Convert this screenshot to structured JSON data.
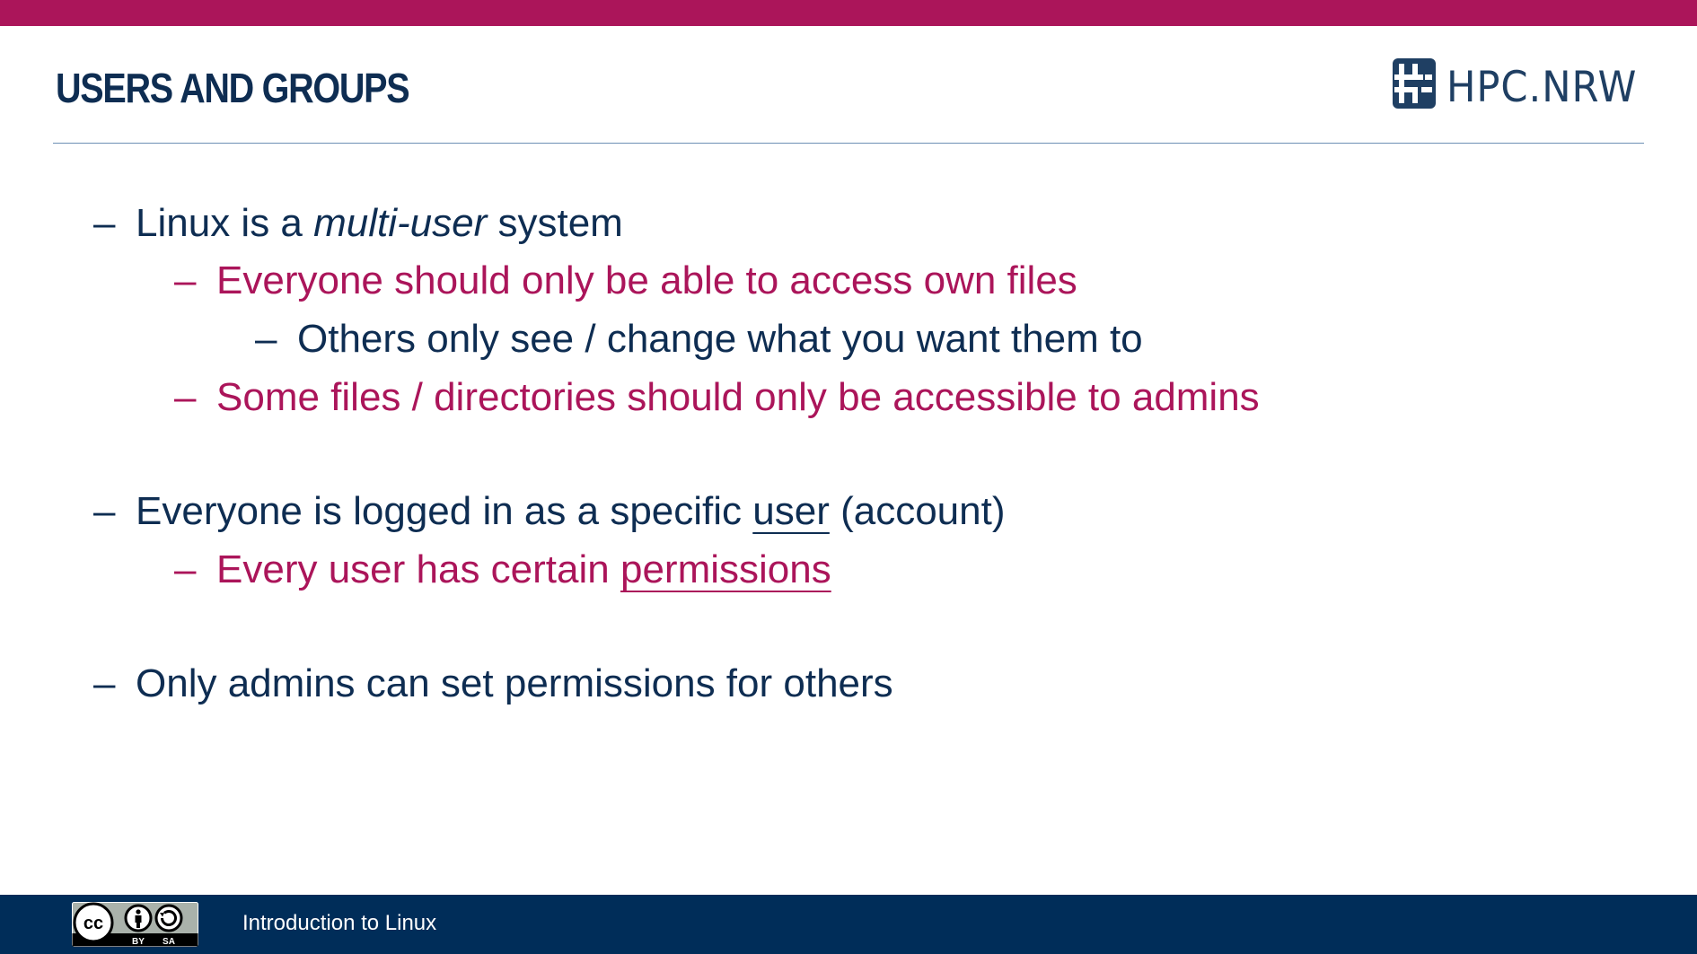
{
  "slide": {
    "title": "USERS AND GROUPS"
  },
  "logo": {
    "text": "HPC.NRW",
    "icon": "hash-tile-icon"
  },
  "bullets": [
    {
      "dash": "–",
      "parts": [
        "Linux is a ",
        "multi-user",
        " system"
      ]
    },
    {
      "dash": "–",
      "text": "Everyone should only be able to access own files"
    },
    {
      "dash": "–",
      "text": "Others only see / change what you want them to"
    },
    {
      "dash": "–",
      "text": "Some files / directories should only be accessible to admins"
    },
    {
      "dash": "–",
      "parts": [
        "Everyone is logged in as a specific ",
        "user",
        " (account)"
      ]
    },
    {
      "dash": "–",
      "parts": [
        "Every user has certain ",
        "permissions"
      ]
    },
    {
      "dash": "–",
      "text": "Only admins can set permissions for others"
    }
  ],
  "footer": {
    "text": "Introduction to Linux",
    "license_badge": {
      "icon": "cc-by-sa-icon",
      "labels": [
        "BY",
        "SA"
      ]
    }
  },
  "colors": {
    "accent": "#ab155a",
    "navy": "#0e2d52",
    "footer_bg": "#002d59",
    "rule": "#6e90b5"
  }
}
